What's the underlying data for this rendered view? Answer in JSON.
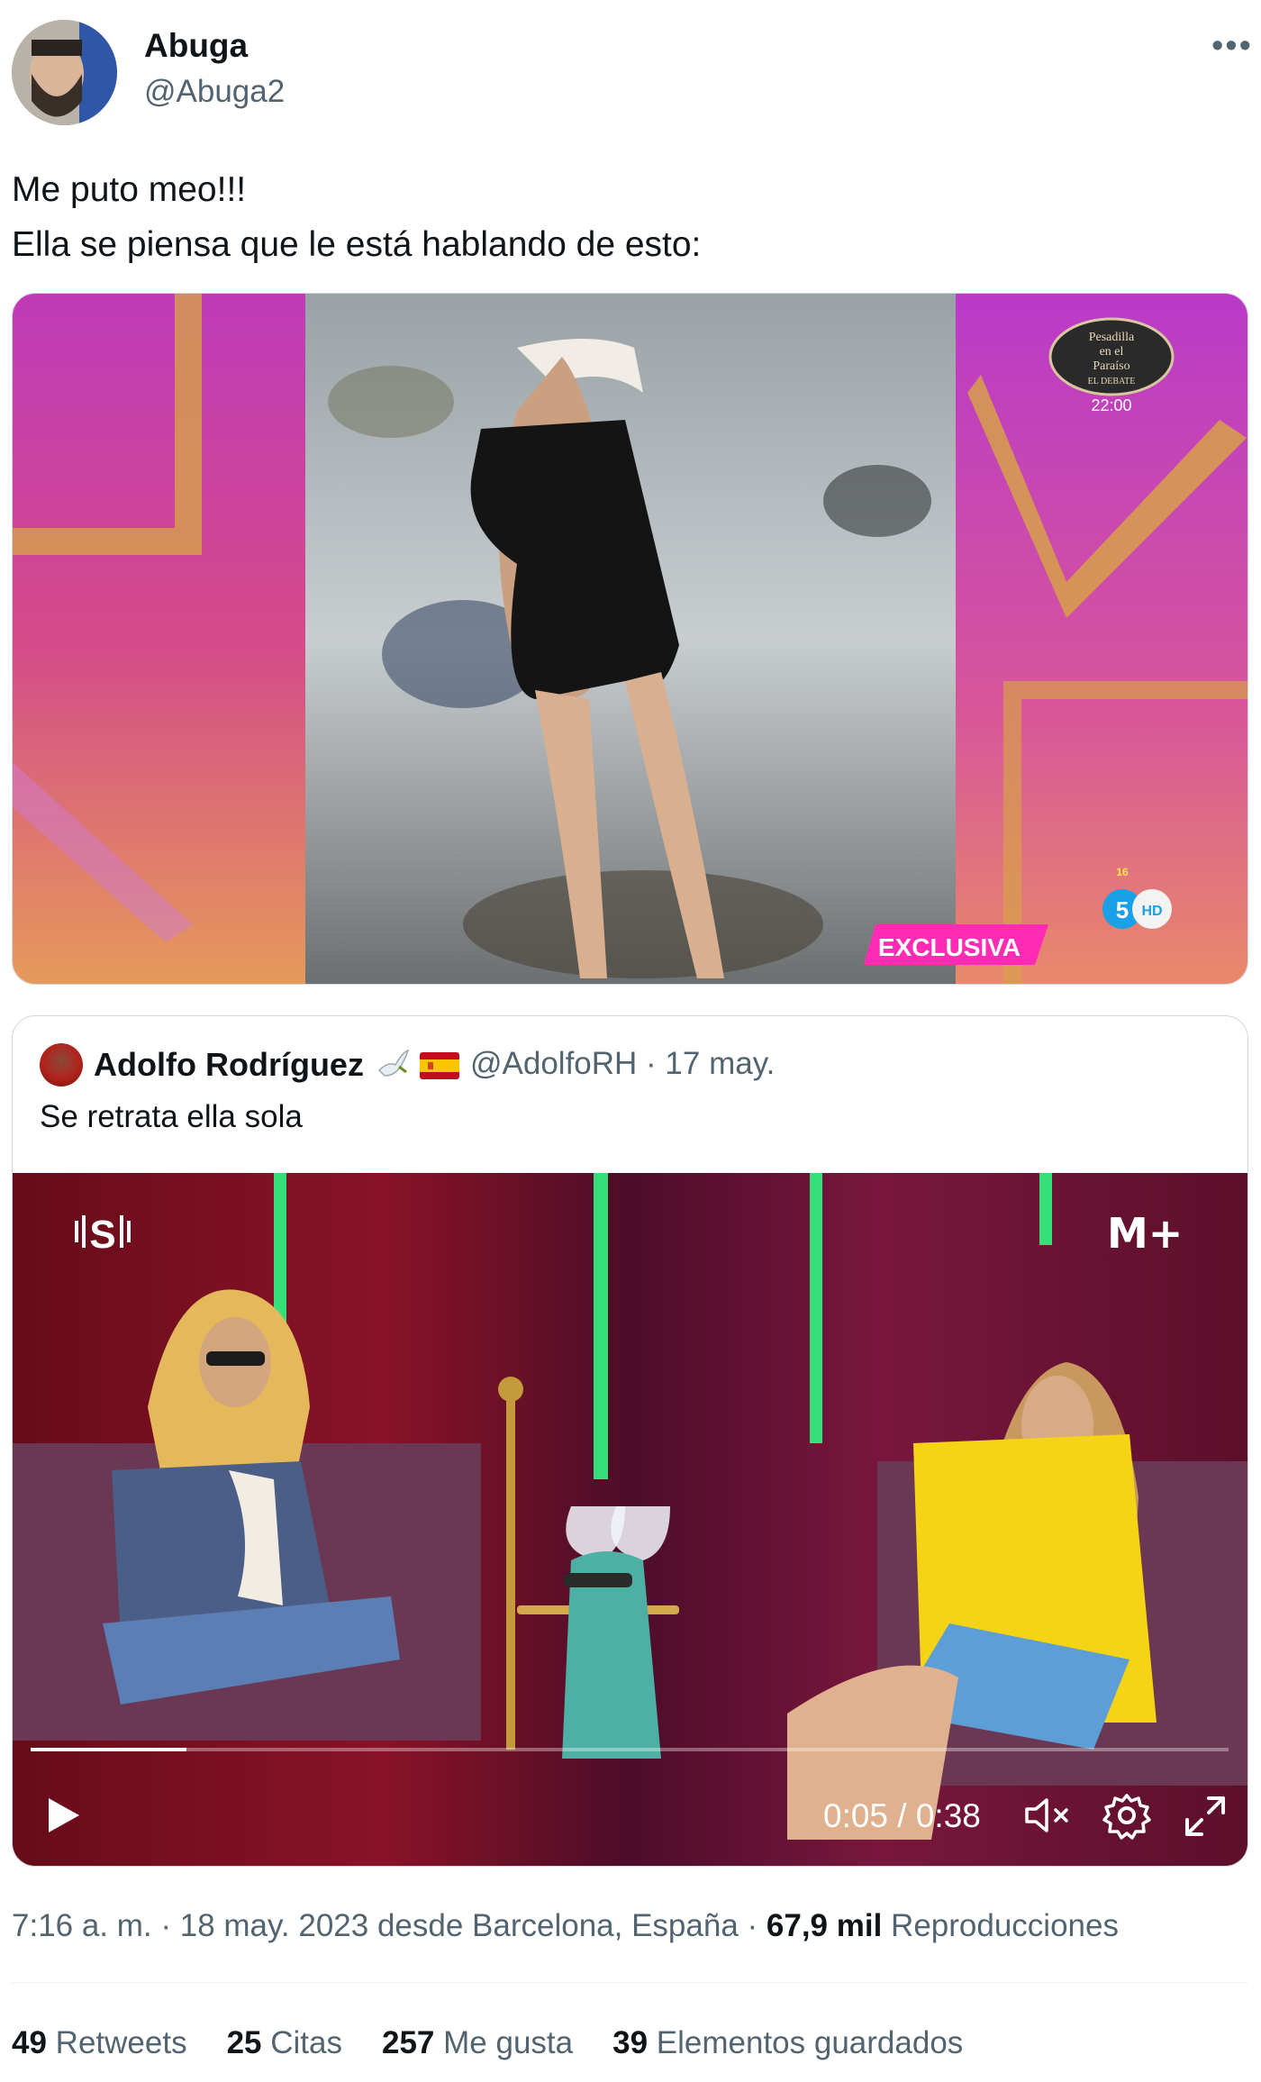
{
  "author": {
    "name": "Abuga",
    "handle": "@Abuga2"
  },
  "more_icon_glyph": "•••",
  "tweet": {
    "lines": [
      "Me puto meo!!!",
      "Ella se piensa que le está hablando de esto:"
    ]
  },
  "media_1": {
    "logo_text": [
      "Pesadilla",
      "en el",
      "Paraíso",
      "EL DEBATE"
    ],
    "time_overlay": "22:00",
    "exclusive_label": "EXCLUSIVA",
    "channel_badge": "5",
    "hd_badge": "HD",
    "age_badge": "16"
  },
  "quoted_tweet": {
    "name": "Adolfo Rodríguez",
    "emojis": [
      "dove",
      "spain-flag"
    ],
    "handle_date": "@AdolfoRH · 17 may.",
    "text": "Se retrata ella sola",
    "video": {
      "channel_logo_left": "S",
      "channel_logo_right": "M+",
      "time": "0:05 / 0:38",
      "progress": 0.13
    }
  },
  "meta": {
    "timestamp": "7:16 a. m. · 18 may. 2023 desde Barcelona, España · ",
    "views_count": "67,9 mil",
    "views_label": " Reproducciones"
  },
  "stats": [
    {
      "count": "49",
      "label": "Retweets"
    },
    {
      "count": "25",
      "label": "Citas"
    },
    {
      "count": "257",
      "label": "Me gusta"
    },
    {
      "count": "39",
      "label": "Elementos guardados"
    }
  ],
  "colors": {
    "text": "#0f1419",
    "secondary": "#536471",
    "border": "#cfd9de",
    "exclusive_pink": "#ff2bb3"
  }
}
